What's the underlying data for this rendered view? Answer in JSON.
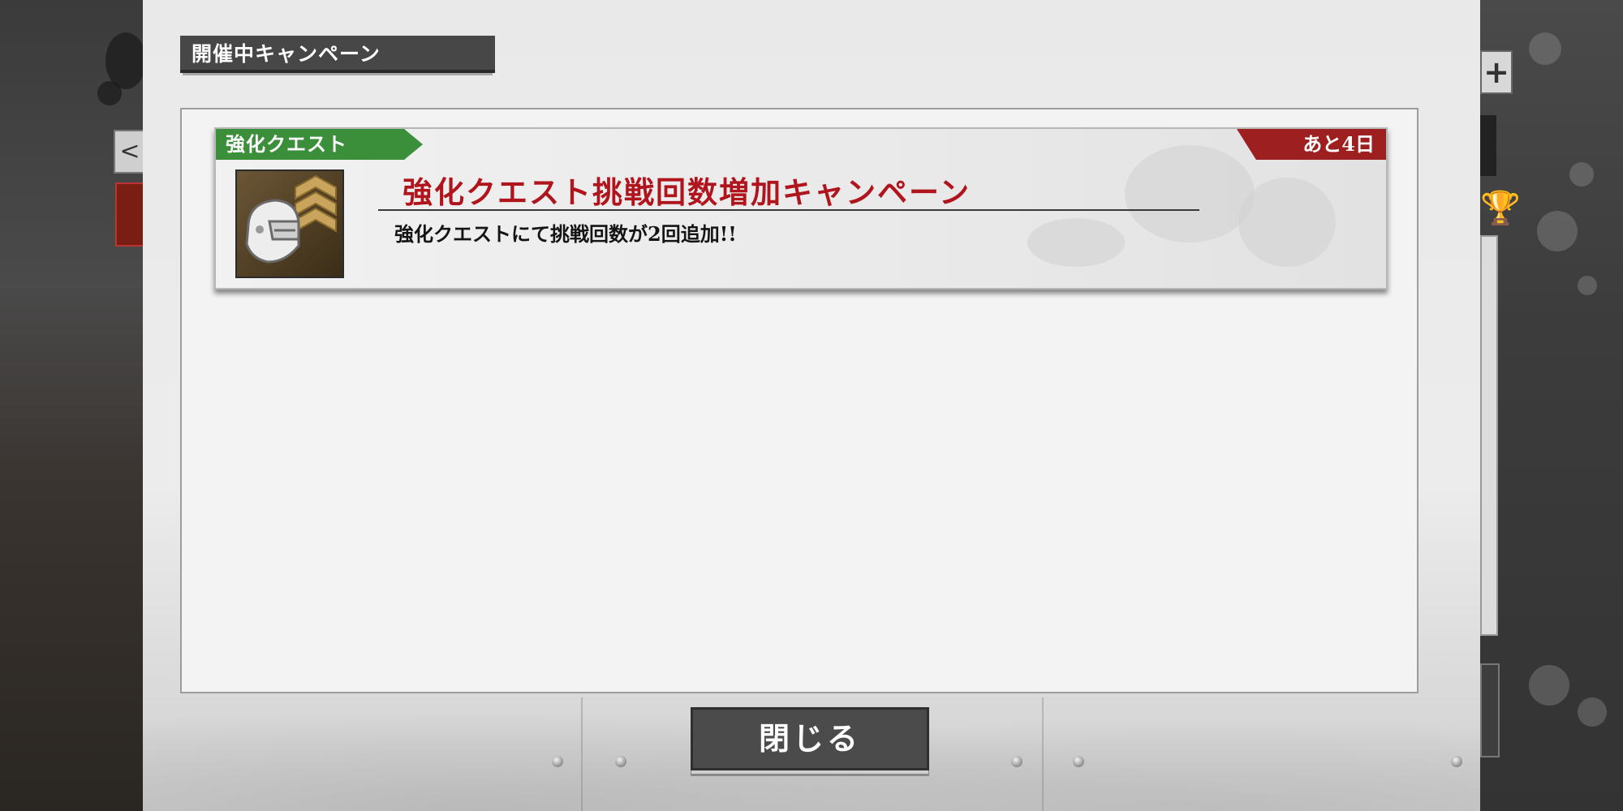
{
  "dialog": {
    "header_title": "開催中キャンペーン",
    "close_label": "閉じる"
  },
  "campaigns": [
    {
      "category": "強化クエスト",
      "remaining": "あと4日",
      "title": "強化クエスト挑戦回数増加キャンペーン",
      "description": "強化クエストにて挑戦回数が2回追加!!",
      "icon": "helmet-chevron-icon"
    }
  ],
  "background": {
    "back_button_glyph": "<",
    "plus_button_glyph": "+",
    "trophy_icon": "trophy-icon"
  },
  "colors": {
    "category_tag": "#3b8f3a",
    "remaining_tag": "#9e1f1f",
    "title_red": "#b0141c",
    "header_bg": "#474747",
    "button_bg": "#4b4b4b"
  }
}
